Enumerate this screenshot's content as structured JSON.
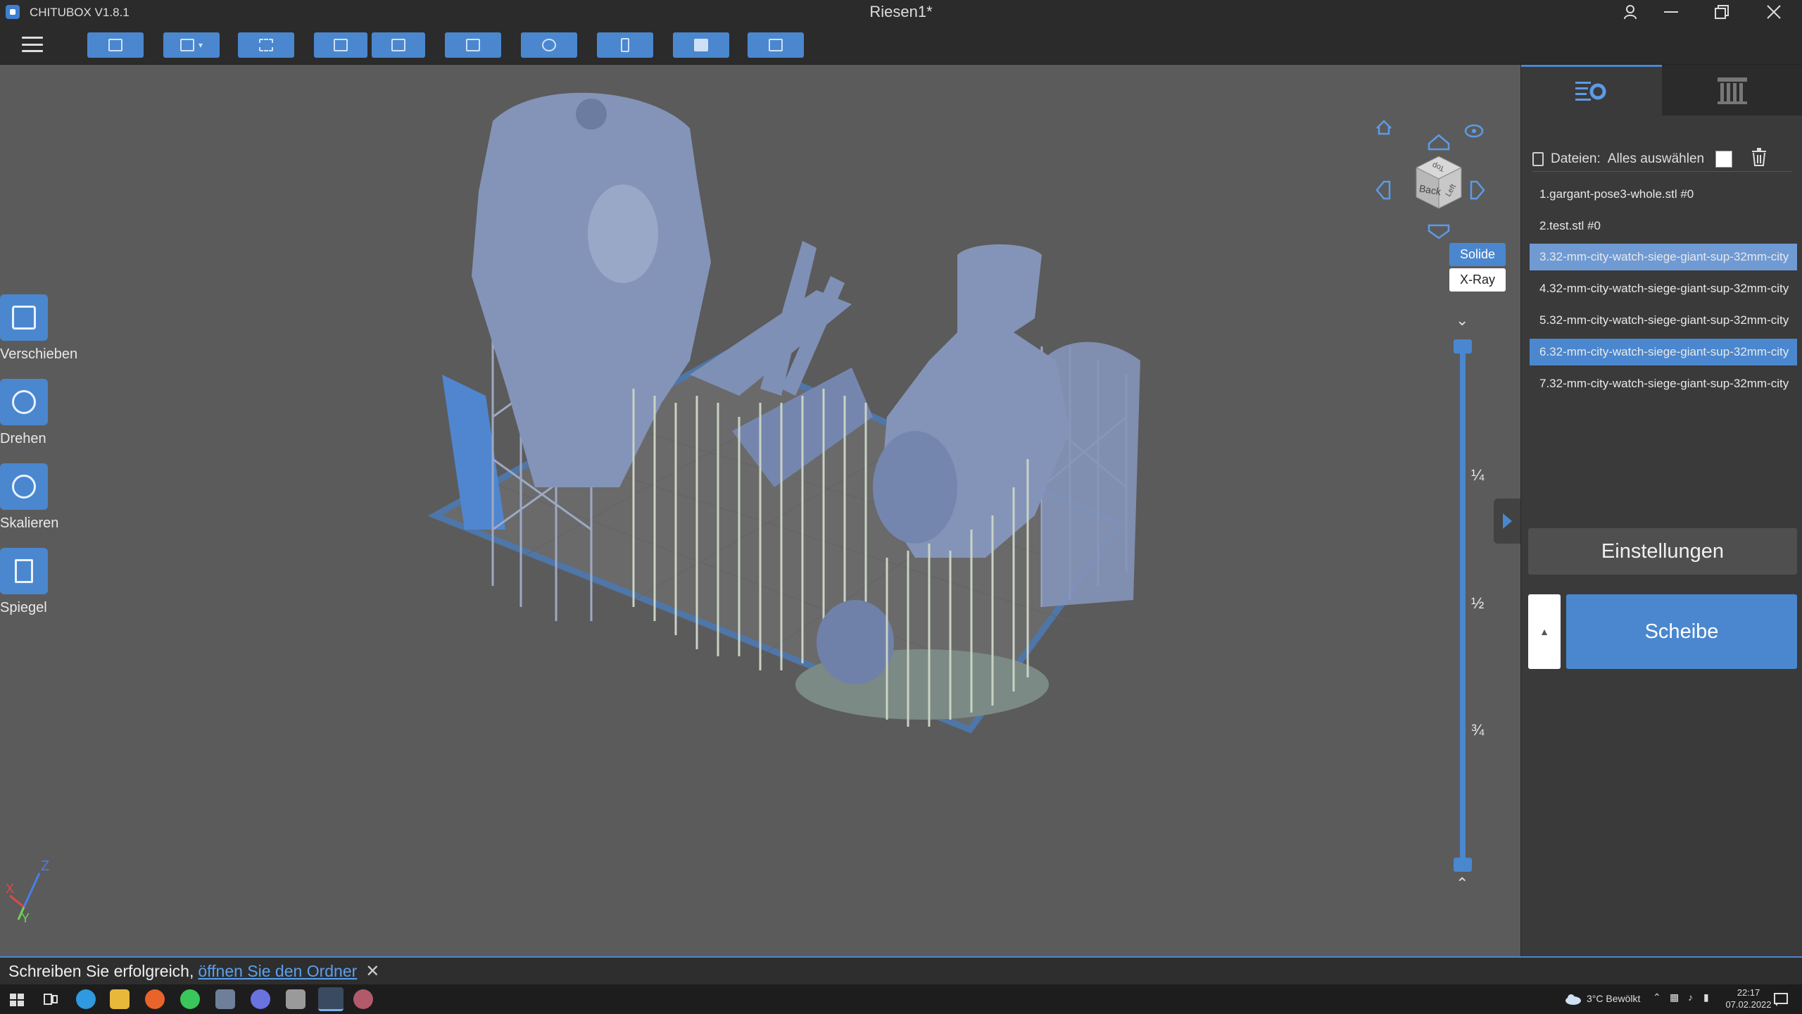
{
  "window": {
    "app_name": "CHITUBOX V1.8.1",
    "title": "Riesen1*"
  },
  "toolbar": {
    "icons": [
      "menu-icon",
      "open-folder-icon",
      "save-icon",
      "auto-layout-icon",
      "undo-icon",
      "redo-icon",
      "layers-icon",
      "group-icon",
      "support-icon",
      "hollow-icon",
      "drill-icon"
    ]
  },
  "left_tools": {
    "move": "Verschieben",
    "rotate": "Drehen",
    "scale": "Skalieren",
    "mirror": "Spiegel"
  },
  "view": {
    "solid": "Solide",
    "xray": "X-Ray",
    "cube_faces": [
      "Top",
      "Back",
      "Left"
    ]
  },
  "layer_slider": {
    "marks": [
      "¼",
      "½",
      "¾"
    ]
  },
  "files": {
    "label": "Dateien:",
    "select_all": "Alles auswählen",
    "items": [
      {
        "name": "1.gargant-pose3-whole.stl #0",
        "state": "normal"
      },
      {
        "name": "2.test.stl #0",
        "state": "normal"
      },
      {
        "name": "3.32-mm-city-watch-siege-giant-sup-32mm-city",
        "state": "selected-light"
      },
      {
        "name": "4.32-mm-city-watch-siege-giant-sup-32mm-city",
        "state": "normal"
      },
      {
        "name": "5.32-mm-city-watch-siege-giant-sup-32mm-city",
        "state": "normal"
      },
      {
        "name": "6.32-mm-city-watch-siege-giant-sup-32mm-city",
        "state": "selected"
      },
      {
        "name": "7.32-mm-city-watch-siege-giant-sup-32mm-city",
        "state": "normal"
      }
    ]
  },
  "actions": {
    "settings": "Einstellungen",
    "slice": "Scheibe"
  },
  "status": {
    "message": "Schreiben Sie erfolgreich,",
    "link": "öffnen Sie den Ordner"
  },
  "axes": {
    "z": "Z",
    "x": "X",
    "y": "Y"
  },
  "taskbar": {
    "weather": "3°C  Bewölkt",
    "time": "22:17",
    "date": "07.02.2022"
  },
  "colors": {
    "accent": "#4a87cf",
    "model": "#8494b8",
    "support": "#c9d2c4",
    "plate": "#4f76a8"
  }
}
